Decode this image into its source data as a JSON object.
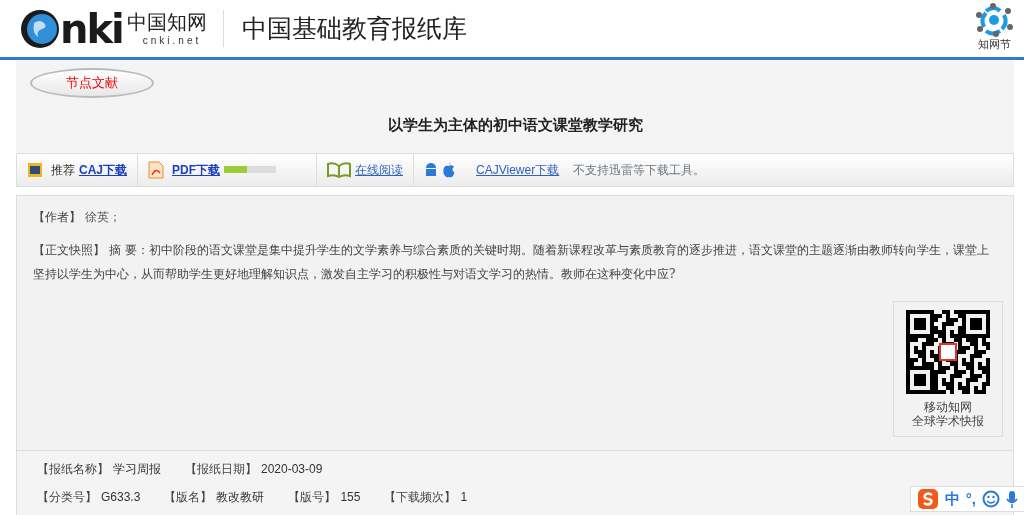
{
  "header": {
    "logo_mark": "nki",
    "logo_cn": "中国知网",
    "logo_domain": "cnki.net",
    "title": "中国基础教育报纸库",
    "right_logo_text": "知网节"
  },
  "node_tab": {
    "label": "节点文献"
  },
  "article_title": "以学生为主体的初中语文课堂教学研究",
  "toolbar": [
    {
      "kind": "caj",
      "prefix": "推荐",
      "label": "CAJ下载"
    },
    {
      "kind": "pdf",
      "label": "PDF下载",
      "level": 0.45
    },
    {
      "kind": "read",
      "label": "在线阅读"
    },
    {
      "kind": "app",
      "label": "CAJViewer下载"
    },
    {
      "kind": "note",
      "label": "不支持迅雷等下载工具。"
    }
  ],
  "author": {
    "label": "【作者】",
    "value": "徐英；"
  },
  "snapshot": {
    "label": "【正文快照】",
    "text": "摘 要：初中阶段的语文课堂是集中提升学生的文学素养与综合素质的关键时期。随着新课程改革与素质教育的逐步推进，语文课堂的主题逐渐由教师转向学生，课堂上坚持以学生为中心，从而帮助学生更好地理解知识点，激发自主学习的积极性与对语文学习的热情。教师在这种变化中应?"
  },
  "qr": {
    "caption": [
      "移动知网",
      "全球学术快报"
    ]
  },
  "meta_rows": [
    [
      {
        "label": "【报纸名称】",
        "value": "学习周报"
      },
      {
        "label": "【报纸日期】",
        "value": "2020-03-09"
      }
    ],
    [
      {
        "label": "【分类号】",
        "value": "G633.3"
      },
      {
        "label": "【版名】",
        "value": "教改教研"
      },
      {
        "label": "【版号】",
        "value": "155"
      },
      {
        "label": "【下载频次】",
        "value": "1"
      }
    ]
  ],
  "ime_bar": {
    "mode": "中",
    "punct": "°,"
  }
}
